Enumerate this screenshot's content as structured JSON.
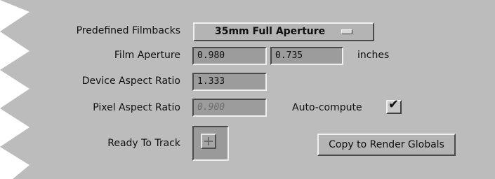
{
  "filmback": {
    "predefined_label": "Predefined Filmbacks",
    "predefined_value": "35mm Full Aperture",
    "aperture_label": "Film Aperture",
    "aperture_width": "0.980",
    "aperture_height": "0.735",
    "aperture_unit": "inches",
    "device_aspect_label": "Device Aspect Ratio",
    "device_aspect_value": "1.333",
    "pixel_aspect_label": "Pixel Aspect Ratio",
    "pixel_aspect_value": "0.900",
    "autocompute_label": "Auto-compute",
    "autocompute_checked": true,
    "ready_label": "Ready To Track",
    "copy_button": "Copy to Render Globals"
  },
  "colors": {
    "panel_bg": "#bcbcbc",
    "field_bg": "#9c9c9c",
    "button_bg": "#b4b4b4"
  }
}
